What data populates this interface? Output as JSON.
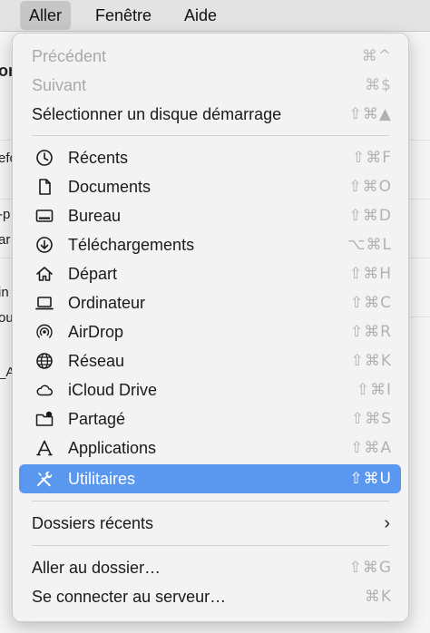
{
  "menubar": {
    "items": [
      {
        "label": "Aller",
        "active": true
      },
      {
        "label": "Fenêtre",
        "active": false
      },
      {
        "label": "Aide",
        "active": false
      }
    ]
  },
  "background": {
    "fragments": [
      "on",
      "efo",
      "-p",
      "ar",
      "in",
      "ou",
      "_A"
    ]
  },
  "menu": {
    "top_items": [
      {
        "label": "Précédent",
        "shortcut": "⌘^",
        "disabled": true
      },
      {
        "label": "Suivant",
        "shortcut": "⌘$",
        "disabled": true
      },
      {
        "label": "Sélectionner un disque démarrage",
        "shortcut": "⇧⌘▲",
        "disabled": false
      }
    ],
    "places": [
      {
        "label": "Récents",
        "shortcut": "⇧⌘F",
        "icon": "clock-icon"
      },
      {
        "label": "Documents",
        "shortcut": "⇧⌘O",
        "icon": "document-icon"
      },
      {
        "label": "Bureau",
        "shortcut": "⇧⌘D",
        "icon": "desktop-icon"
      },
      {
        "label": "Téléchargements",
        "shortcut": "⌥⌘L",
        "icon": "download-icon"
      },
      {
        "label": "Départ",
        "shortcut": "⇧⌘H",
        "icon": "home-icon"
      },
      {
        "label": "Ordinateur",
        "shortcut": "⇧⌘C",
        "icon": "laptop-icon"
      },
      {
        "label": "AirDrop",
        "shortcut": "⇧⌘R",
        "icon": "airdrop-icon"
      },
      {
        "label": "Réseau",
        "shortcut": "⇧⌘K",
        "icon": "globe-icon"
      },
      {
        "label": "iCloud Drive",
        "shortcut": "⇧⌘I",
        "icon": "cloud-icon"
      },
      {
        "label": "Partagé",
        "shortcut": "⇧⌘S",
        "icon": "shared-folder-icon"
      },
      {
        "label": "Applications",
        "shortcut": "⇧⌘A",
        "icon": "applications-icon"
      },
      {
        "label": "Utilitaires",
        "shortcut": "⇧⌘U",
        "icon": "utilities-icon",
        "highlighted": true
      }
    ],
    "recent_folders": {
      "label": "Dossiers récents",
      "chevron": "›"
    },
    "bottom_items": [
      {
        "label": "Aller au dossier…",
        "shortcut": "⇧⌘G"
      },
      {
        "label": "Se connecter au serveur…",
        "shortcut": "⌘K"
      }
    ]
  },
  "colors": {
    "highlight": "#5a97ee",
    "shortcut": "#b2b2b2",
    "disabled": "#a9a9a9"
  }
}
